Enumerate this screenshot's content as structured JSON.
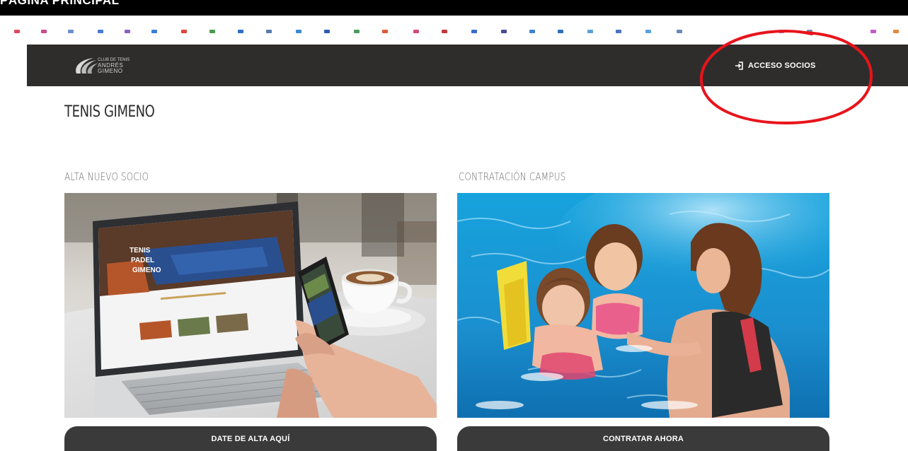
{
  "caption": "PÁGINA PRINCIPAL",
  "header": {
    "logo_line1": "CLUB DE TENIS",
    "logo_line2": "ANDRÉS",
    "logo_line3": "GIMENO",
    "access_label": "ACCESO SOCIOS",
    "access_icon": "login-icon",
    "background": "#2e2d2c"
  },
  "page_title": "TENIS GIMENO",
  "cards": [
    {
      "title": "ALTA NUEVO SOCIO",
      "image": "laptop-phone-coffee-photo",
      "button_label": "DATE DE ALTA AQUÍ"
    },
    {
      "title": "CONTRATACIÓN CAMPUS",
      "image": "kids-swimming-pool-photo",
      "button_label": "CONTRATAR AHORA"
    }
  ],
  "colors": {
    "annotation_red": "#e8141b",
    "button_bg": "#3a3a3a",
    "pool_blue": "#1aa0d8"
  }
}
